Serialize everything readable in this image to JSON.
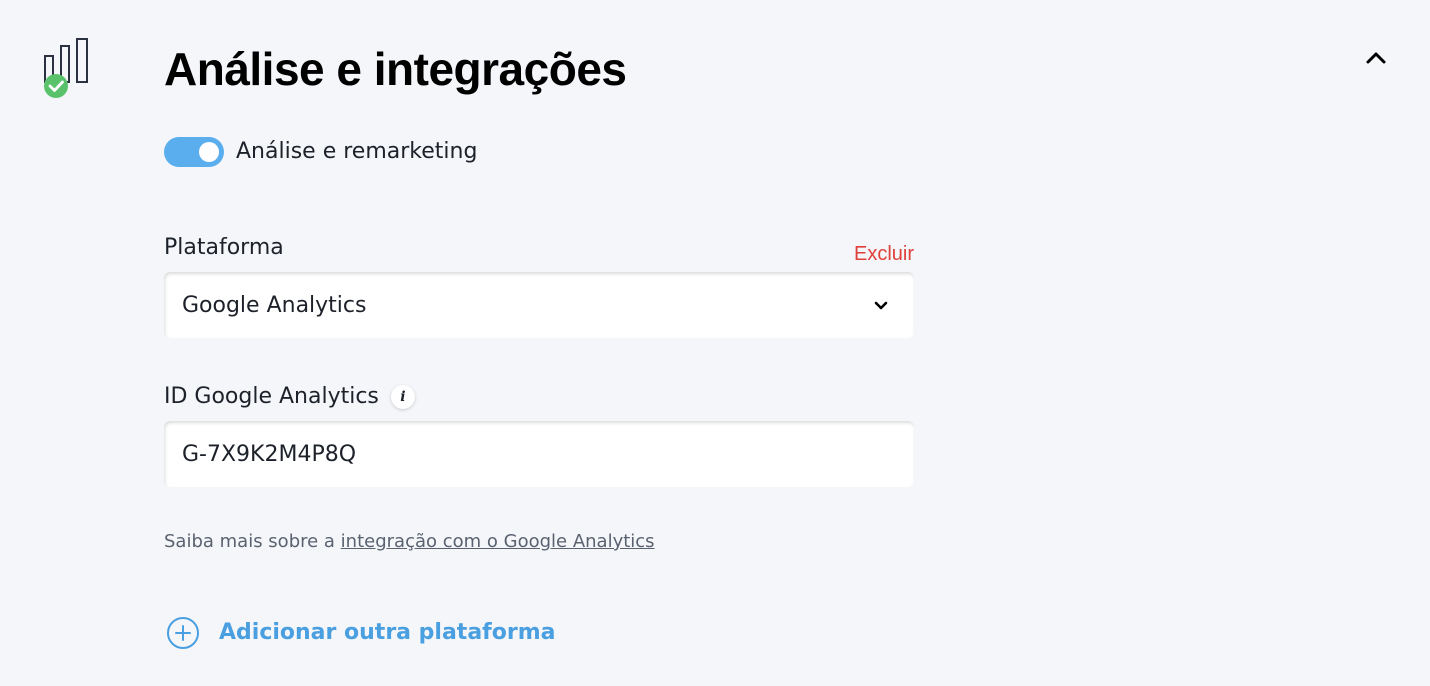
{
  "section": {
    "icon": "analytics-chart-check-icon",
    "title": "Análise e integrações",
    "collapse_icon": "chevron-up-icon"
  },
  "toggle": {
    "label": "Análise e remarketing",
    "enabled": true,
    "accent_color": "#5aaeed"
  },
  "platform": {
    "label": "Plataforma",
    "delete_label": "Excluir",
    "delete_color": "#e0403a",
    "selected_value": "Google Analytics",
    "dropdown_icon": "chevron-down-icon"
  },
  "ga_id": {
    "label": "ID Google Analytics",
    "info_icon": "info-icon",
    "info_glyph": "i",
    "value": "G-7X9K2M4P8Q"
  },
  "help": {
    "prefix": "Saiba mais sobre a ",
    "link_text": "integração com o Google Analytics"
  },
  "add_platform": {
    "icon": "plus-circle-icon",
    "label": "Adicionar outra plataforma",
    "color": "#4a9fe0"
  }
}
